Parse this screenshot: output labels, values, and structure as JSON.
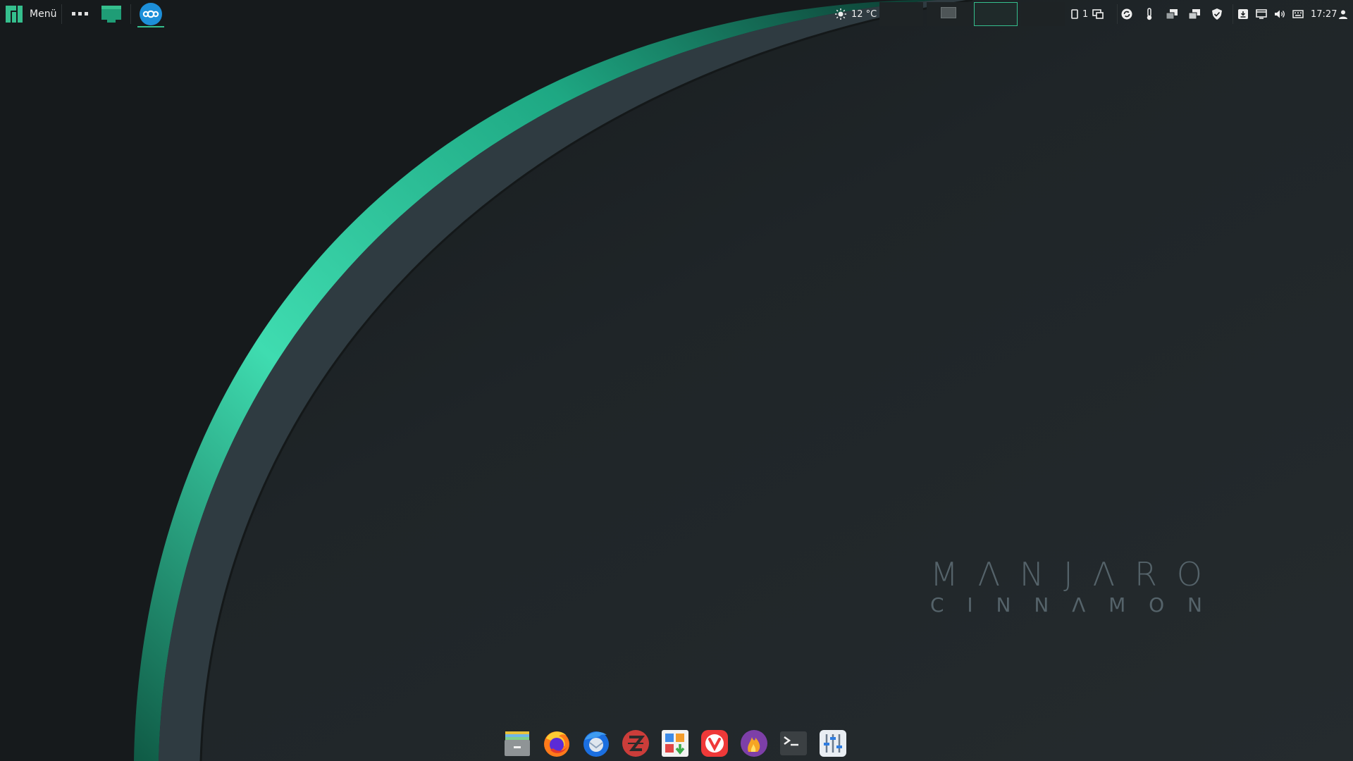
{
  "top_panel": {
    "menu_label": "Menü",
    "weather": {
      "icon": "sun-icon",
      "temperature": "12 °C"
    },
    "workspaces": [
      {
        "name": "workspace-1",
        "has_window": false,
        "active": false
      },
      {
        "name": "workspace-2",
        "has_window": true,
        "active": false
      },
      {
        "name": "workspace-3",
        "has_window": false,
        "active": true
      },
      {
        "name": "workspace-4",
        "has_window": false,
        "active": false
      }
    ],
    "workspace_count": "1",
    "tray_icons": [
      "sync-icon",
      "thermometer-icon",
      "window-list-icon",
      "window-stack-icon",
      "shield-icon",
      "download-icon",
      "display-icon",
      "volume-icon",
      "keyboard-icon"
    ],
    "clock": "17:27",
    "user_icon": "user-icon"
  },
  "watermark": {
    "title_letters": [
      "M",
      "Λ",
      "N",
      "J",
      "Λ",
      "R",
      "O"
    ],
    "subtitle_letters": [
      "C",
      "I",
      "N",
      "N",
      "Λ",
      "M",
      "O",
      "N"
    ]
  },
  "dock": {
    "apps": [
      "file-manager-icon",
      "firefox-icon",
      "thunderbird-icon",
      "zotero-icon",
      "software-store-icon",
      "vivaldi-icon",
      "flame-app-icon",
      "terminal-icon",
      "mixer-settings-icon"
    ]
  },
  "colors": {
    "accent": "#35bf8d",
    "panel_bg": "#171b1d",
    "desktop_bg": "#242a2d",
    "watermark": "#55636a"
  }
}
